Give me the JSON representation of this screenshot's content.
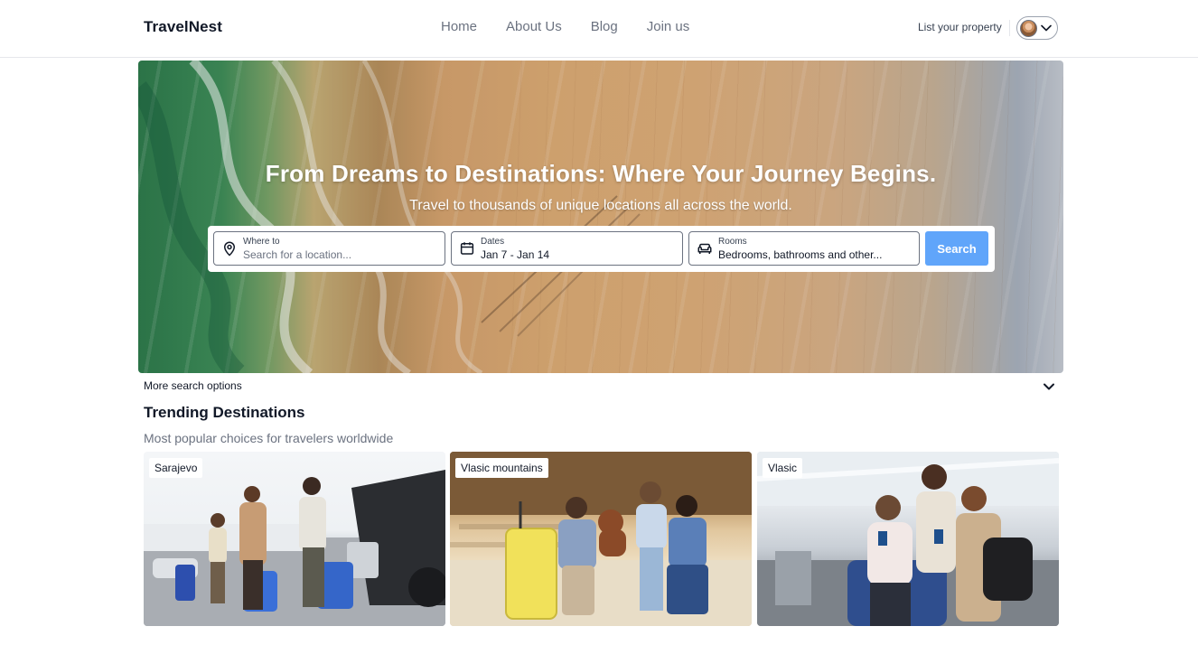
{
  "header": {
    "logo": "TravelNest",
    "nav": [
      "Home",
      "About Us",
      "Blog",
      "Join us"
    ],
    "list_property": "List your property",
    "avatar_icon": "user-avatar",
    "menu_icon": "chevron-down-icon"
  },
  "hero": {
    "title": "From Dreams to Destinations: Where Your Journey Begins.",
    "subtitle": "Travel to thousands of unique locations all across the world."
  },
  "search": {
    "where": {
      "label": "Where to",
      "placeholder": "Search for a location...",
      "icon": "map-pin-icon"
    },
    "dates": {
      "label": "Dates",
      "value": "Jan 7 - Jan 14",
      "icon": "calendar-icon"
    },
    "rooms": {
      "label": "Rooms",
      "value": "Bedrooms, bathrooms and other...",
      "icon": "sofa-icon"
    },
    "button": "Search",
    "button_color": "#60a5fa"
  },
  "more_options": {
    "label": "More search options",
    "icon": "chevron-down-icon"
  },
  "trending": {
    "title": "Trending Destinations",
    "subtitle": "Most popular choices for travelers worldwide",
    "cards": [
      {
        "label": "Sarajevo"
      },
      {
        "label": "Vlasic mountains"
      },
      {
        "label": "Vlasic"
      }
    ]
  }
}
